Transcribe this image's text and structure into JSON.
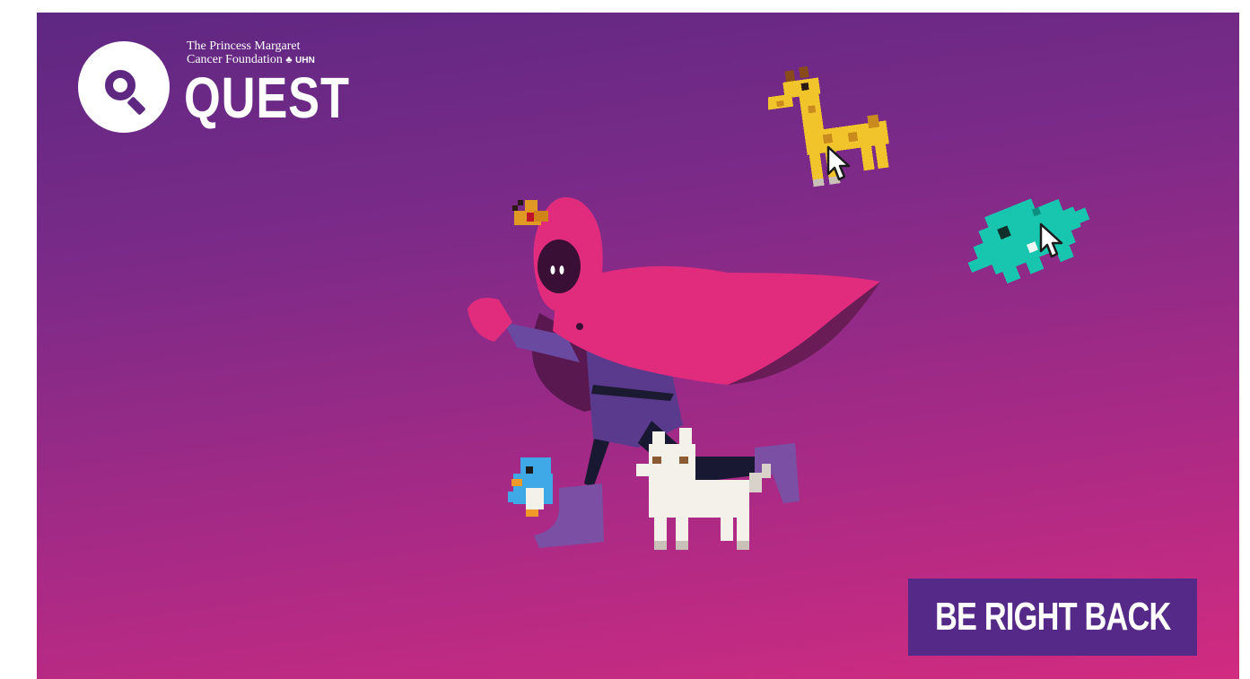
{
  "brand": {
    "org_line1": "The Princess Margaret",
    "org_line2": "Cancer Foundation",
    "leaf_glyph": "♣",
    "uhn": "UHN",
    "title": "QUEST",
    "logo_icon": "search-icon"
  },
  "banner": {
    "label": "BE RIGHT BACK"
  },
  "colors": {
    "bg_top": "#5e2882",
    "bg_bottom": "#d12b80",
    "banner_bg": "#552988",
    "cape": "#e12c7e",
    "giraffe": "#f1c42b",
    "teal_creature": "#18c6b0",
    "bird": "#3ea9e6",
    "dog": "#f4f1ea"
  }
}
